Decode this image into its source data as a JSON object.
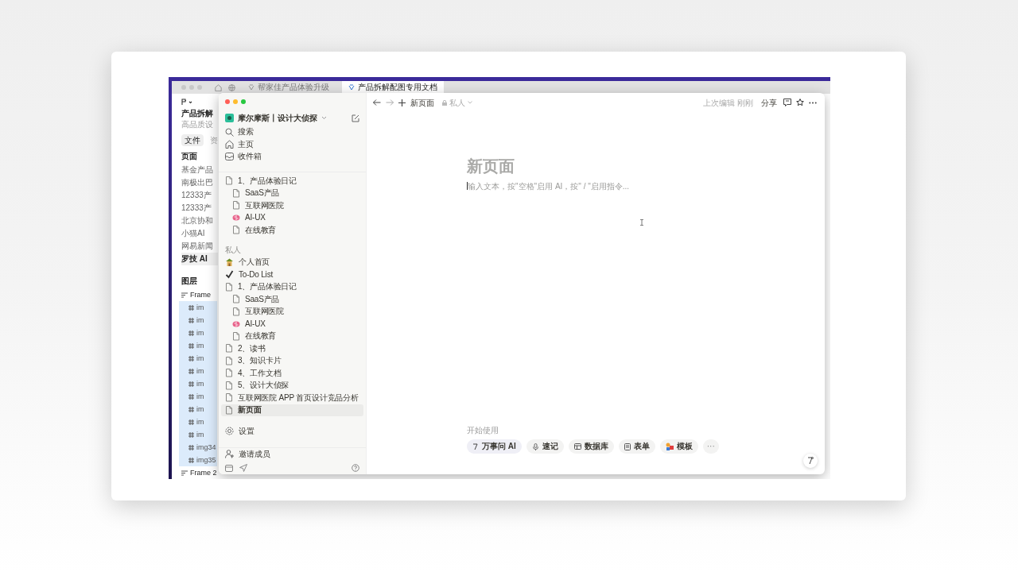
{
  "browser": {
    "tabs": [
      {
        "label": "帮家佳产品体验升级",
        "selected": false
      },
      {
        "label": "产品拆解配图专用文档",
        "selected": true
      }
    ]
  },
  "design_panel": {
    "title": "产品拆解",
    "subtitle": "高品质设",
    "tabs": [
      {
        "label": "文件",
        "selected": true
      },
      {
        "label": "资",
        "selected": false
      }
    ],
    "pages_heading": "页面",
    "pages": [
      {
        "label": "基金产品",
        "selected": false
      },
      {
        "label": "南极出巴",
        "selected": false
      },
      {
        "label": "12333产",
        "selected": false
      },
      {
        "label": "12333产",
        "selected": false
      },
      {
        "label": "北京协和",
        "selected": false
      },
      {
        "label": "小猫AI",
        "selected": false
      },
      {
        "label": "网易新闻",
        "selected": false
      },
      {
        "label": "罗技 AI",
        "selected": true
      }
    ],
    "layers_heading": "图层",
    "layers": [
      {
        "label": "Frame",
        "selected": false,
        "children": [
          {
            "label": "im",
            "selected": true
          },
          {
            "label": "im",
            "selected": true
          },
          {
            "label": "im",
            "selected": true
          },
          {
            "label": "im",
            "selected": true
          },
          {
            "label": "im",
            "selected": true
          },
          {
            "label": "im",
            "selected": true
          },
          {
            "label": "im",
            "selected": true
          },
          {
            "label": "im",
            "selected": true
          },
          {
            "label": "im",
            "selected": true
          },
          {
            "label": "im",
            "selected": true
          },
          {
            "label": "im",
            "selected": true
          },
          {
            "label": "img34",
            "selected": true
          },
          {
            "label": "img35",
            "selected": true
          }
        ]
      },
      {
        "label": "Frame 2",
        "selected": false
      }
    ]
  },
  "notion": {
    "workspace": "摩尔摩斯丨设计大侦探",
    "nav": [
      {
        "kind": "search",
        "label": "搜索"
      },
      {
        "kind": "home",
        "label": "主页"
      },
      {
        "kind": "inbox",
        "label": "收件箱"
      }
    ],
    "team_pages": [
      {
        "kind": "page",
        "label": "1、产品体验日记",
        "selected": false,
        "children": [
          {
            "kind": "page",
            "label": "SaaS产品",
            "selected": false
          },
          {
            "kind": "page",
            "label": "互联网医院",
            "selected": false
          },
          {
            "kind": "brain",
            "label": "AI-UX",
            "selected": false
          },
          {
            "kind": "page",
            "label": "在线教育",
            "selected": false
          }
        ]
      }
    ],
    "private_heading": "私人",
    "private_pages": [
      {
        "kind": "figure",
        "label": "个人首页",
        "selected": false
      },
      {
        "kind": "check",
        "label": "To-Do List",
        "selected": false
      },
      {
        "kind": "page",
        "label": "1、产品体验日记",
        "selected": false,
        "children": [
          {
            "kind": "page",
            "label": "SaaS产品",
            "selected": false
          },
          {
            "kind": "page",
            "label": "互联网医院",
            "selected": false
          },
          {
            "kind": "brain",
            "label": "AI-UX",
            "selected": false
          },
          {
            "kind": "page",
            "label": "在线教育",
            "selected": false
          }
        ]
      },
      {
        "kind": "page",
        "label": "2、读书",
        "selected": false
      },
      {
        "kind": "page",
        "label": "3、知识卡片",
        "selected": false
      },
      {
        "kind": "page",
        "label": "4、工作文档",
        "selected": false
      },
      {
        "kind": "page",
        "label": "5、设计大侦探",
        "selected": false
      },
      {
        "kind": "page",
        "label": "互联网医院 APP 首页设计竞品分析",
        "selected": false
      },
      {
        "kind": "page",
        "label": "新页面",
        "selected": true
      }
    ],
    "settings": "设置",
    "invite": "邀请成员",
    "topbar": {
      "title": "新页面",
      "privacy": "私人",
      "edited": "上次编辑 刚刚",
      "share": "分享"
    },
    "page": {
      "title_placeholder": "新页面",
      "body_placeholder": "输入文本，按\"空格\"启用 AI，按\" / \"启用指令..."
    },
    "start": {
      "heading": "开始使用",
      "actions": [
        {
          "kind": "ai",
          "label": "万事问 AI"
        },
        {
          "kind": "note",
          "label": "速记"
        },
        {
          "kind": "database",
          "label": "数据库"
        },
        {
          "kind": "form",
          "label": "表单"
        },
        {
          "kind": "template",
          "label": "模板"
        },
        {
          "kind": "more",
          "label": "···"
        }
      ]
    }
  }
}
